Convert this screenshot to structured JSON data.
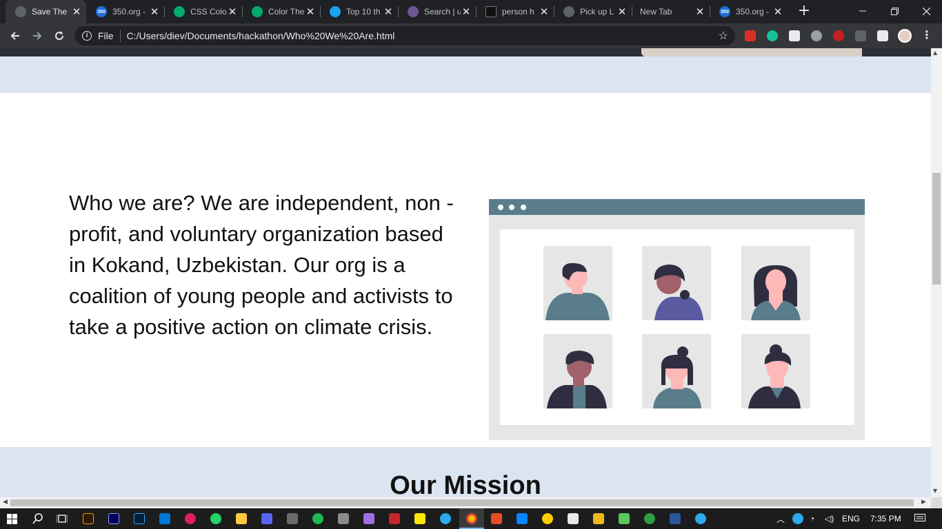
{
  "browser": {
    "tabs": [
      {
        "title": "Save The",
        "favicon": "globe-icon",
        "color": "#5f6368",
        "active": true
      },
      {
        "title": "350.org -",
        "favicon": "350-icon",
        "color": "#1e6fd9"
      },
      {
        "title": "CSS Colo",
        "favicon": "w-icon",
        "color": "#04aa6d"
      },
      {
        "title": "Color The",
        "favicon": "w-icon",
        "color": "#04aa6d"
      },
      {
        "title": "Top 10 th",
        "favicon": "s-icon",
        "color": "#1da1f2"
      },
      {
        "title": "Search | u",
        "favicon": "github-icon",
        "color": "#6e5494"
      },
      {
        "title": "person h",
        "favicon": "unsplash-icon",
        "color": "#111111"
      },
      {
        "title": "Pick up L",
        "favicon": "globe-icon",
        "color": "#5f6368"
      },
      {
        "title": "New Tab",
        "favicon": "",
        "color": ""
      },
      {
        "title": "350.org -",
        "favicon": "350-icon",
        "color": "#1e6fd9"
      }
    ],
    "favicon_350_text": "350",
    "new_tab_glyph": "+",
    "close_glyph": "✕",
    "address": {
      "scheme_label": "File",
      "url": "C:/Users/diev/Documents/hackathon/Who%20We%20Are.html"
    }
  },
  "page": {
    "about_text": "Who we are? We are independent, non - profit, and voluntary organization based in Kokand, Uzbekistan. Our org is a coalition of young people and activists to take a positive action on climate crisis.",
    "mission_title": "Our Mission",
    "colors": {
      "band": "#dbe5f1",
      "illus_header": "#5a7d8c",
      "illus_frame": "#e6e6e6",
      "tile": "#e6e6e6",
      "shirt_teal": "#5a7d8c",
      "shirt_purple": "#5a5aa0",
      "shirt_dark": "#2f2e41",
      "skin_light": "#ffb8b8",
      "skin_dark": "#a0616a",
      "hair": "#2f2e41"
    }
  },
  "taskbar": {
    "language": "ENG",
    "time": "7:35 PM"
  }
}
